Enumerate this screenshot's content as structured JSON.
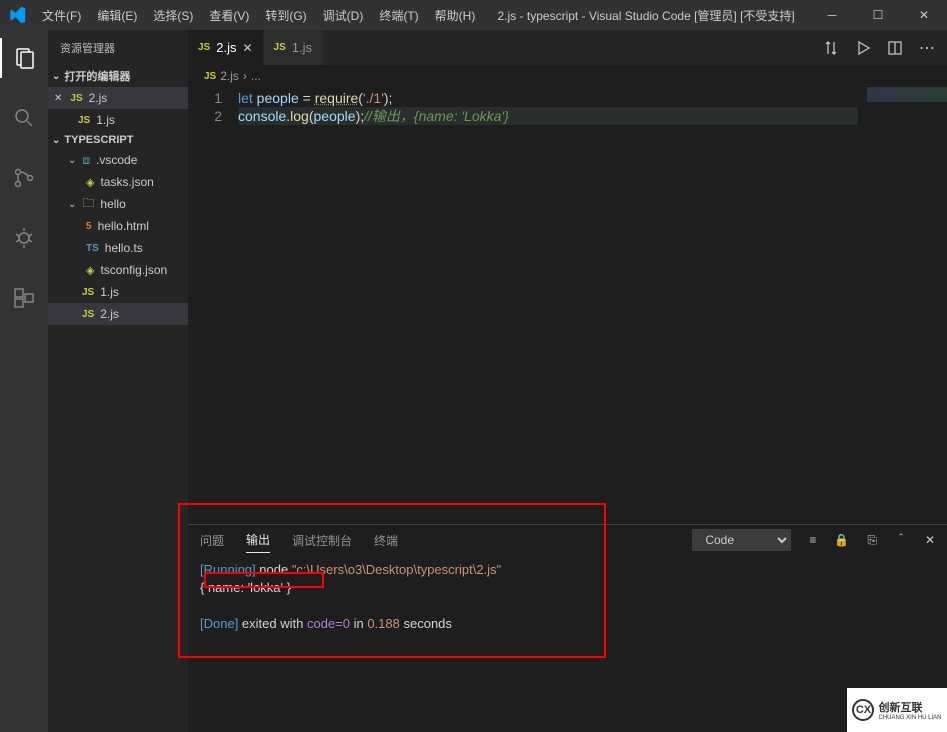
{
  "title": "2.js - typescript - Visual Studio Code [管理员] [不受支持]",
  "menu": {
    "file": "文件(F)",
    "edit": "编辑(E)",
    "select": "选择(S)",
    "view": "查看(V)",
    "goto": "转到(G)",
    "debug": "调试(D)",
    "terminal": "终端(T)",
    "help": "帮助(H)"
  },
  "sidebar": {
    "header": "资源管理器",
    "open_editors": "打开的编辑器",
    "open_items": [
      "2.js",
      "1.js"
    ],
    "project": "TYPESCRIPT",
    "tree": {
      "vscode": ".vscode",
      "tasks": "tasks.json",
      "hello": "hello",
      "hello_html": "hello.html",
      "hello_ts": "hello.ts",
      "tsconfig": "tsconfig.json",
      "f1": "1.js",
      "f2": "2.js"
    }
  },
  "tabs": {
    "t1": "2.js",
    "t2": "1.js"
  },
  "breadcrumb": {
    "file": "2.js",
    "sep": "›",
    "more": "..."
  },
  "code": {
    "ln1": "1",
    "ln2": "2",
    "l1_let": "let",
    "l1_people": " people ",
    "l1_eq": "= ",
    "l1_require": "require",
    "l1_p1": "(",
    "l1_str": "'./1'",
    "l1_p2": ");",
    "l2_console": "console",
    "l2_dot": ".",
    "l2_log": "log",
    "l2_p1": "(",
    "l2_people": "people",
    "l2_p2": ");",
    "l2_cm": "//输出，{name: 'Lokka'}"
  },
  "panel": {
    "tabs": {
      "problems": "问题",
      "output": "输出",
      "debug": "调试控制台",
      "terminal": "终端"
    },
    "selector": "Code",
    "out": {
      "running": "[Running]",
      "node": " node ",
      "path": "\"c:\\Users\\o3\\Desktop\\typescript\\2.js\"",
      "line2": "{ name: 'lokka' }",
      "done": "[Done]",
      "exited": " exited with ",
      "code": "code=0",
      "in": " in ",
      "time": "0.188",
      "sec": " seconds"
    }
  },
  "watermark": {
    "logo": "CX",
    "text1": "创新互联",
    "text2": "CHUANG XIN HU LIAN"
  }
}
